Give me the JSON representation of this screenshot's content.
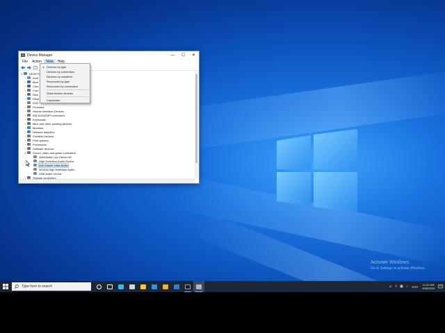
{
  "window": {
    "title": "Device Manager",
    "minimize_glyph": "—",
    "maximize_glyph": "☐",
    "close_glyph": "✕"
  },
  "menubar": {
    "items": [
      {
        "label": "File"
      },
      {
        "label": "Action"
      },
      {
        "label": "View"
      },
      {
        "label": "Help"
      }
    ]
  },
  "toolbar": {
    "back_icon": "back-arrow-icon",
    "forward_icon": "forward-arrow-icon",
    "properties_icon": "properties-icon"
  },
  "tree": {
    "root_label": "DESKTO",
    "rows": [
      {
        "label": "Audi",
        "expanded": false,
        "color": "#6d8fb7"
      },
      {
        "label": "Blue",
        "expanded": false,
        "color": "#2a6cc7"
      },
      {
        "label": "Cam",
        "expanded": false,
        "color": "#555d66"
      },
      {
        "label": "Com",
        "expanded": false,
        "color": "#5e7388"
      },
      {
        "label": "Disk",
        "expanded": false,
        "color": "#6a6f75"
      },
      {
        "label": "Displ",
        "expanded": false,
        "color": "#3b88c9"
      },
      {
        "label": "DVD",
        "expanded": false,
        "color": "#7a7f86"
      },
      {
        "label": "Firmware",
        "expanded": false,
        "color": "#6f7780"
      },
      {
        "label": "Human Interface Devices",
        "expanded": false,
        "color": "#6e7f91"
      },
      {
        "label": "IDE ATA/ATAPI controllers",
        "expanded": false,
        "color": "#68727d"
      },
      {
        "label": "Keyboards",
        "expanded": false,
        "color": "#5f6a75"
      },
      {
        "label": "Mice and other pointing devices",
        "expanded": false,
        "color": "#5f6a75"
      },
      {
        "label": "Monitors",
        "expanded": false,
        "color": "#3d8bd1"
      },
      {
        "label": "Network adapters",
        "expanded": false,
        "color": "#3f7fbf"
      },
      {
        "label": "Portable Devices",
        "expanded": false,
        "color": "#6a7581"
      },
      {
        "label": "Print queues",
        "expanded": false,
        "color": "#6a7581"
      },
      {
        "label": "Processors",
        "expanded": false,
        "color": "#5b8e4e"
      },
      {
        "label": "Software devices",
        "expanded": false,
        "color": "#6a7581"
      },
      {
        "label": "Sound, video and game controllers",
        "expanded": true,
        "color": "#6a7581"
      },
      {
        "label": "AVerMedia Live Gamer 4K",
        "child": true,
        "color": "#7f8891"
      },
      {
        "label": "High Definition Audio Device",
        "child": true,
        "color": "#7f8891"
      },
      {
        "label": "Live Gamer Ultra-Audio",
        "child": true,
        "selected": true,
        "color": "#7f8891"
      },
      {
        "label": "NVIDIA High Definition Audio",
        "child": true,
        "color": "#7f8891"
      },
      {
        "label": "USB Audio Device",
        "child": true,
        "color": "#7f8891"
      },
      {
        "label": "Storage controllers",
        "expanded": false,
        "color": "#6a7581"
      }
    ]
  },
  "view_menu": {
    "items": [
      {
        "label": "Devices by type",
        "checked": true
      },
      {
        "label": "Devices by connection"
      },
      {
        "label": "Devices by container"
      },
      {
        "label": "Resources by type"
      },
      {
        "label": "Resources by connection"
      },
      {
        "separator": true
      },
      {
        "label": "Show hidden devices"
      },
      {
        "separator": true
      },
      {
        "label": "Customize..."
      }
    ],
    "check_glyph": "●"
  },
  "desktop": {
    "watermark_title": "Activate Windows",
    "watermark_sub": "Go to Settings to activate Windows."
  },
  "taskbar": {
    "search_placeholder": "Type here to search",
    "apps": [
      {
        "name": "cortana-icon",
        "color": "#ffffff"
      },
      {
        "name": "task-view-icon",
        "color": "#ffffff"
      },
      {
        "name": "edge-icon",
        "color": "#3fb7e6"
      },
      {
        "name": "store-icon",
        "color": "#cfd8e3"
      },
      {
        "name": "file-explorer-icon",
        "color": "#f2c64a"
      },
      {
        "name": "mail-icon",
        "color": "#3d8de0"
      },
      {
        "name": "chrome-icon",
        "color": "#e9b43b"
      },
      {
        "name": "photos-icon",
        "color": "#3a7ad1"
      },
      {
        "name": "terminal-icon",
        "color": "#1e1e1e",
        "running": true
      },
      {
        "name": "device-manager-taskbar-icon",
        "color": "#a9b6c6",
        "running": true,
        "focused": true
      }
    ],
    "tray": {
      "language": "ENG",
      "time": "11:22 AM",
      "date": "9/30/2020"
    }
  },
  "accent_color": "#0078d7"
}
